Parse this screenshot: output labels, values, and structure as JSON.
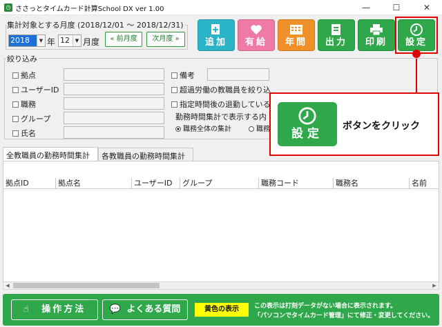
{
  "window": {
    "title": "ささっとタイムカード計算School DX  ver 1.00",
    "minimize": "—",
    "maximize": "☐",
    "close": "✕"
  },
  "period": {
    "label": "集計対象とする月度 (2018/12/01 〜 2018/12/31)",
    "year": "2018",
    "year_unit": "年",
    "month": "12",
    "month_unit": "月度",
    "prev_label": "« 前月度",
    "next_label": "次月度 »"
  },
  "toolbar": {
    "add": "追加",
    "paid_leave": "有給",
    "annual": "年間",
    "output": "出力",
    "print": "印刷",
    "settings": "設定"
  },
  "filter": {
    "title": "絞り込み",
    "branch": "拠点",
    "user_id": "ユーザーID",
    "position": "職務",
    "group": "グループ",
    "name": "氏名",
    "note": "備考",
    "overtime_opt": "超過労働の教職員を絞り込",
    "late_opt": "指定時間後の退勤している",
    "display_label": "勤務時間集計で表示する内",
    "radio_all": "職務全体の集計",
    "radio_each": "職務"
  },
  "tabs": {
    "all": "全教職員の勤務時間集計",
    "each": "各教職員の勤務時間集計"
  },
  "table": {
    "columns": [
      "拠点ID",
      "拠点名",
      "ユーザーID",
      "グループ",
      "職務コード",
      "職務名",
      "名前"
    ]
  },
  "footer": {
    "manual": "操作方法",
    "faq": "よくある質問",
    "yellow_label": "黄色の表示",
    "note_line1": "この表示は打刻データがない場合に表示されます。",
    "note_line2": "「パソコンでタイムカード管理」にて修正・変更してください。"
  },
  "callout": {
    "button_label": "設定",
    "text": "ボタンをクリック"
  },
  "colors": {
    "add": "#2bb3c8",
    "paid_leave": "#f07aa6",
    "annual": "#f09028",
    "output": "#2ea84a",
    "print": "#2ea84a",
    "settings": "#2ea84a",
    "highlight": "#e00000",
    "footer": "#2ea84a"
  }
}
